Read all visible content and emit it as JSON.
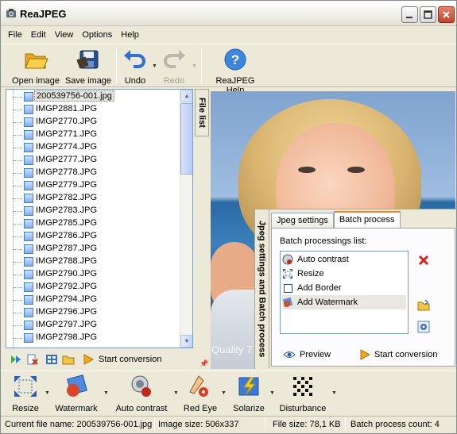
{
  "window": {
    "title": "ReaJPEG"
  },
  "menu": [
    "File",
    "Edit",
    "View",
    "Options",
    "Help"
  ],
  "toolbar": {
    "open_image": "Open image",
    "save_image": "Save image",
    "undo": "Undo",
    "redo": "Redo",
    "help": "ReaJPEG Help"
  },
  "file_list": {
    "tab_label": "File list",
    "files": [
      "200539756-001.jpg",
      "IMGP2881.JPG",
      "IMGP2770.JPG",
      "IMGP2771.JPG",
      "IMGP2774.JPG",
      "IMGP2777.JPG",
      "IMGP2778.JPG",
      "IMGP2779.JPG",
      "IMGP2782.JPG",
      "IMGP2783.JPG",
      "IMGP2785.JPG",
      "IMGP2786.JPG",
      "IMGP2787.JPG",
      "IMGP2788.JPG",
      "IMGP2790.JPG",
      "IMGP2792.JPG",
      "IMGP2794.JPG",
      "IMGP2796.JPG",
      "IMGP2797.JPG",
      "IMGP2798.JPG"
    ],
    "selected_index": 0,
    "start_conversion": "Start conversion"
  },
  "preview": {
    "quality_text": "Quality 7"
  },
  "settings_panel": {
    "vertical_label": "Jpeg settings and Batch process",
    "tabs": [
      "Jpeg settings",
      "Batch process"
    ],
    "active_tab": "Batch process",
    "batch_list_label": "Batch processings list:",
    "batch_items": [
      "Auto contrast",
      "Resize",
      "Add Border",
      "Add Watermark"
    ],
    "preview_button": "Preview",
    "start_conversion": "Start conversion"
  },
  "effects": [
    "Resize",
    "Watermark",
    "Auto contrast",
    "Red Eye",
    "Solarize",
    "Disturbance"
  ],
  "status": {
    "current_file": "Current file name:  200539756-001.jpg",
    "image_size": "Image size:  506x337",
    "file_size": "File size:  78,1 KB",
    "batch_count": "Batch process count:  4"
  }
}
